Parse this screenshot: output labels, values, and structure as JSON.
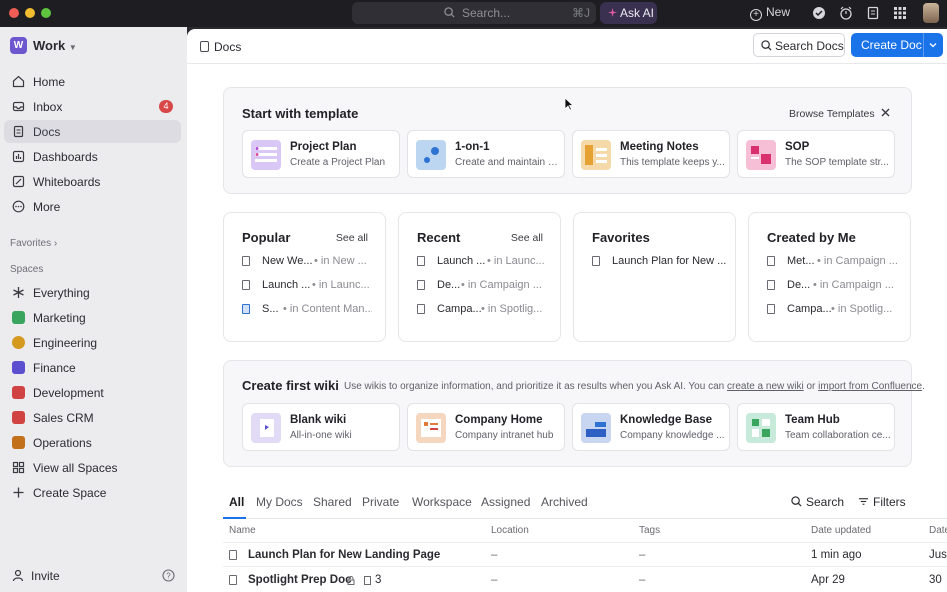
{
  "titlebar": {
    "search_placeholder": "Search...",
    "search_shortcut": "⌘J",
    "ask_ai": "Ask AI",
    "new": "New"
  },
  "sidebar": {
    "workspace_initial": "W",
    "workspace_name": "Work",
    "nav": [
      {
        "label": "Home",
        "icon": "home-icon"
      },
      {
        "label": "Inbox",
        "icon": "inbox-icon",
        "badge": "4"
      },
      {
        "label": "Docs",
        "icon": "docs-icon",
        "active": true
      },
      {
        "label": "Dashboards",
        "icon": "dashboard-icon"
      },
      {
        "label": "Whiteboards",
        "icon": "whiteboard-icon"
      },
      {
        "label": "More",
        "icon": "more-icon"
      }
    ],
    "favorites_label": "Favorites",
    "spaces_label": "Spaces",
    "spaces": [
      {
        "label": "Everything",
        "color": "#6a6a72"
      },
      {
        "label": "Marketing",
        "color": "#3aa55c"
      },
      {
        "label": "Engineering",
        "color": "#d39a1f"
      },
      {
        "label": "Finance",
        "color": "#5b4fcf"
      },
      {
        "label": "Development",
        "color": "#d14343"
      },
      {
        "label": "Sales CRM",
        "color": "#d14343"
      },
      {
        "label": "Operations",
        "color": "#c2701a"
      },
      {
        "label": "View all Spaces",
        "color": "#6a6a72"
      },
      {
        "label": "Create Space",
        "color": "#6a6a72"
      }
    ],
    "invite": "Invite"
  },
  "header": {
    "title": "Docs",
    "search_docs": "Search Docs",
    "create_doc": "Create Doc"
  },
  "templates": {
    "title": "Start with template",
    "browse": "Browse Templates",
    "items": [
      {
        "name": "Project Plan",
        "desc": "Create a Project Plan",
        "color": "#d9c7f5"
      },
      {
        "name": "1-on-1",
        "desc": "Create and maintain a...",
        "color": "#bcd6f2"
      },
      {
        "name": "Meeting Notes",
        "desc": "This template keeps y...",
        "color": "#f5d9a8"
      },
      {
        "name": "SOP",
        "desc": "The SOP template str...",
        "color": "#f6bfd6"
      }
    ]
  },
  "columns": [
    {
      "title": "Popular",
      "see_all": "See all",
      "rows": [
        {
          "name": "New We...",
          "loc": "• in New ..."
        },
        {
          "name": "Launch ...",
          "loc": "• in Launc..."
        },
        {
          "name": "S...",
          "loc": "• in Content Man..."
        }
      ]
    },
    {
      "title": "Recent",
      "see_all": "See all",
      "rows": [
        {
          "name": "Launch ...",
          "loc": "• in Launc..."
        },
        {
          "name": "De...",
          "loc": "• in Campaign ..."
        },
        {
          "name": "Campa...",
          "loc": "• in Spotlig..."
        }
      ]
    },
    {
      "title": "Favorites",
      "rows": [
        {
          "name": "Launch Plan for New ...",
          "loc": ""
        }
      ]
    },
    {
      "title": "Created by Me",
      "rows": [
        {
          "name": "Met...",
          "loc": "• in Campaign ..."
        },
        {
          "name": "De...",
          "loc": "• in Campaign ..."
        },
        {
          "name": "Campa...",
          "loc": "• in Spotlig..."
        }
      ]
    }
  ],
  "wiki": {
    "title": "Create first wiki",
    "desc_prefix": "Use wikis to organize information, and prioritize it as results when you Ask AI. You can",
    "link1": "create a new wiki",
    "or": "or",
    "link2": "import from Confluence",
    "period": ".",
    "items": [
      {
        "name": "Blank wiki",
        "desc": "All-in-one wiki",
        "color": "#e2dbf5"
      },
      {
        "name": "Company Home",
        "desc": "Company intranet hub",
        "color": "#f5d6bf"
      },
      {
        "name": "Knowledge Base",
        "desc": "Company knowledge ...",
        "color": "#c9d6f2"
      },
      {
        "name": "Team Hub",
        "desc": "Team collaboration ce...",
        "color": "#c7eadb"
      }
    ]
  },
  "tabs": [
    "All",
    "My Docs",
    "Shared",
    "Private",
    "Workspace",
    "Assigned",
    "Archived"
  ],
  "tab_actions": {
    "search": "Search",
    "filters": "Filters"
  },
  "table": {
    "headers": [
      "Name",
      "Location",
      "Tags",
      "Date updated",
      "Date"
    ],
    "rows": [
      {
        "name": "Launch Plan for New Landing Page",
        "location": "–",
        "tags": "–",
        "updated": "1 min ago",
        "extra": "Jus",
        "subcount": ""
      },
      {
        "name": "Spotlight Prep Doc",
        "location": "–",
        "tags": "–",
        "updated": "Apr 29",
        "extra": "30",
        "subcount": "3"
      }
    ]
  }
}
